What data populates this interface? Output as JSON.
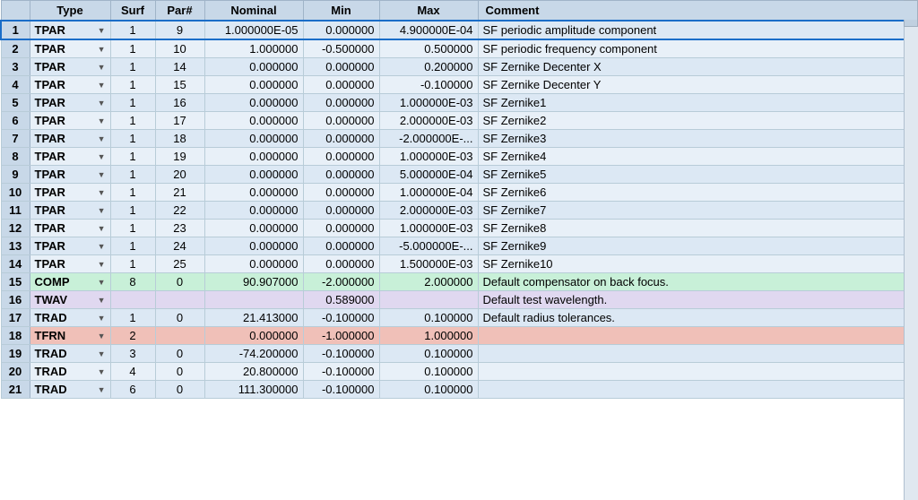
{
  "table": {
    "columns": [
      "",
      "Type",
      "Surf",
      "Par#",
      "Nominal",
      "Min",
      "Max",
      "Comment"
    ],
    "rows": [
      {
        "num": "1",
        "type": "TPAR",
        "surf": "1",
        "par": "9",
        "nominal": "1.000000E-05",
        "min": "0.000000",
        "max": "4.900000E-04",
        "comment": "SF periodic amplitude component",
        "bg": "default",
        "selected": true
      },
      {
        "num": "2",
        "type": "TPAR",
        "surf": "1",
        "par": "10",
        "nominal": "1.000000",
        "min": "-0.500000",
        "max": "0.500000",
        "comment": "SF periodic frequency component",
        "bg": "default"
      },
      {
        "num": "3",
        "type": "TPAR",
        "surf": "1",
        "par": "14",
        "nominal": "0.000000",
        "min": "0.000000",
        "max": "0.200000",
        "comment": "SF Zernike Decenter X",
        "bg": "default"
      },
      {
        "num": "4",
        "type": "TPAR",
        "surf": "1",
        "par": "15",
        "nominal": "0.000000",
        "min": "0.000000",
        "max": "-0.100000",
        "comment": "SF Zernike Decenter Y",
        "bg": "default"
      },
      {
        "num": "5",
        "type": "TPAR",
        "surf": "1",
        "par": "16",
        "nominal": "0.000000",
        "min": "0.000000",
        "max": "1.000000E-03",
        "comment": "SF Zernike1",
        "bg": "default"
      },
      {
        "num": "6",
        "type": "TPAR",
        "surf": "1",
        "par": "17",
        "nominal": "0.000000",
        "min": "0.000000",
        "max": "2.000000E-03",
        "comment": "SF Zernike2",
        "bg": "default"
      },
      {
        "num": "7",
        "type": "TPAR",
        "surf": "1",
        "par": "18",
        "nominal": "0.000000",
        "min": "0.000000",
        "max": "-2.000000E-...",
        "comment": "SF Zernike3",
        "bg": "default"
      },
      {
        "num": "8",
        "type": "TPAR",
        "surf": "1",
        "par": "19",
        "nominal": "0.000000",
        "min": "0.000000",
        "max": "1.000000E-03",
        "comment": "SF Zernike4",
        "bg": "default"
      },
      {
        "num": "9",
        "type": "TPAR",
        "surf": "1",
        "par": "20",
        "nominal": "0.000000",
        "min": "0.000000",
        "max": "5.000000E-04",
        "comment": "SF Zernike5",
        "bg": "default"
      },
      {
        "num": "10",
        "type": "TPAR",
        "surf": "1",
        "par": "21",
        "nominal": "0.000000",
        "min": "0.000000",
        "max": "1.000000E-04",
        "comment": "SF Zernike6",
        "bg": "default"
      },
      {
        "num": "11",
        "type": "TPAR",
        "surf": "1",
        "par": "22",
        "nominal": "0.000000",
        "min": "0.000000",
        "max": "2.000000E-03",
        "comment": "SF Zernike7",
        "bg": "default"
      },
      {
        "num": "12",
        "type": "TPAR",
        "surf": "1",
        "par": "23",
        "nominal": "0.000000",
        "min": "0.000000",
        "max": "1.000000E-03",
        "comment": "SF Zernike8",
        "bg": "default"
      },
      {
        "num": "13",
        "type": "TPAR",
        "surf": "1",
        "par": "24",
        "nominal": "0.000000",
        "min": "0.000000",
        "max": "-5.000000E-...",
        "comment": "SF Zernike9",
        "bg": "default"
      },
      {
        "num": "14",
        "type": "TPAR",
        "surf": "1",
        "par": "25",
        "nominal": "0.000000",
        "min": "0.000000",
        "max": "1.500000E-03",
        "comment": "SF Zernike10",
        "bg": "default"
      },
      {
        "num": "15",
        "type": "COMP",
        "surf": "8",
        "par": "0",
        "nominal": "90.907000",
        "min": "-2.000000",
        "max": "2.000000",
        "comment": "Default compensator on back focus.",
        "bg": "comp"
      },
      {
        "num": "16",
        "type": "TWAV",
        "surf": "",
        "par": "",
        "nominal": "",
        "min": "0.589000",
        "max": "",
        "comment": "Default test wavelength.",
        "bg": "twav"
      },
      {
        "num": "17",
        "type": "TRAD",
        "surf": "1",
        "par": "0",
        "nominal": "21.413000",
        "min": "-0.100000",
        "max": "0.100000",
        "comment": "Default radius tolerances.",
        "bg": "default"
      },
      {
        "num": "18",
        "type": "TFRN",
        "surf": "2",
        "par": "",
        "nominal": "0.000000",
        "min": "-1.000000",
        "max": "1.000000",
        "comment": "",
        "bg": "tfrn"
      },
      {
        "num": "19",
        "type": "TRAD",
        "surf": "3",
        "par": "0",
        "nominal": "-74.200000",
        "min": "-0.100000",
        "max": "0.100000",
        "comment": "",
        "bg": "default"
      },
      {
        "num": "20",
        "type": "TRAD",
        "surf": "4",
        "par": "0",
        "nominal": "20.800000",
        "min": "-0.100000",
        "max": "0.100000",
        "comment": "",
        "bg": "default"
      },
      {
        "num": "21",
        "type": "TRAD",
        "surf": "6",
        "par": "0",
        "nominal": "111.300000",
        "min": "-0.100000",
        "max": "0.100000",
        "comment": "",
        "bg": "default"
      }
    ]
  }
}
